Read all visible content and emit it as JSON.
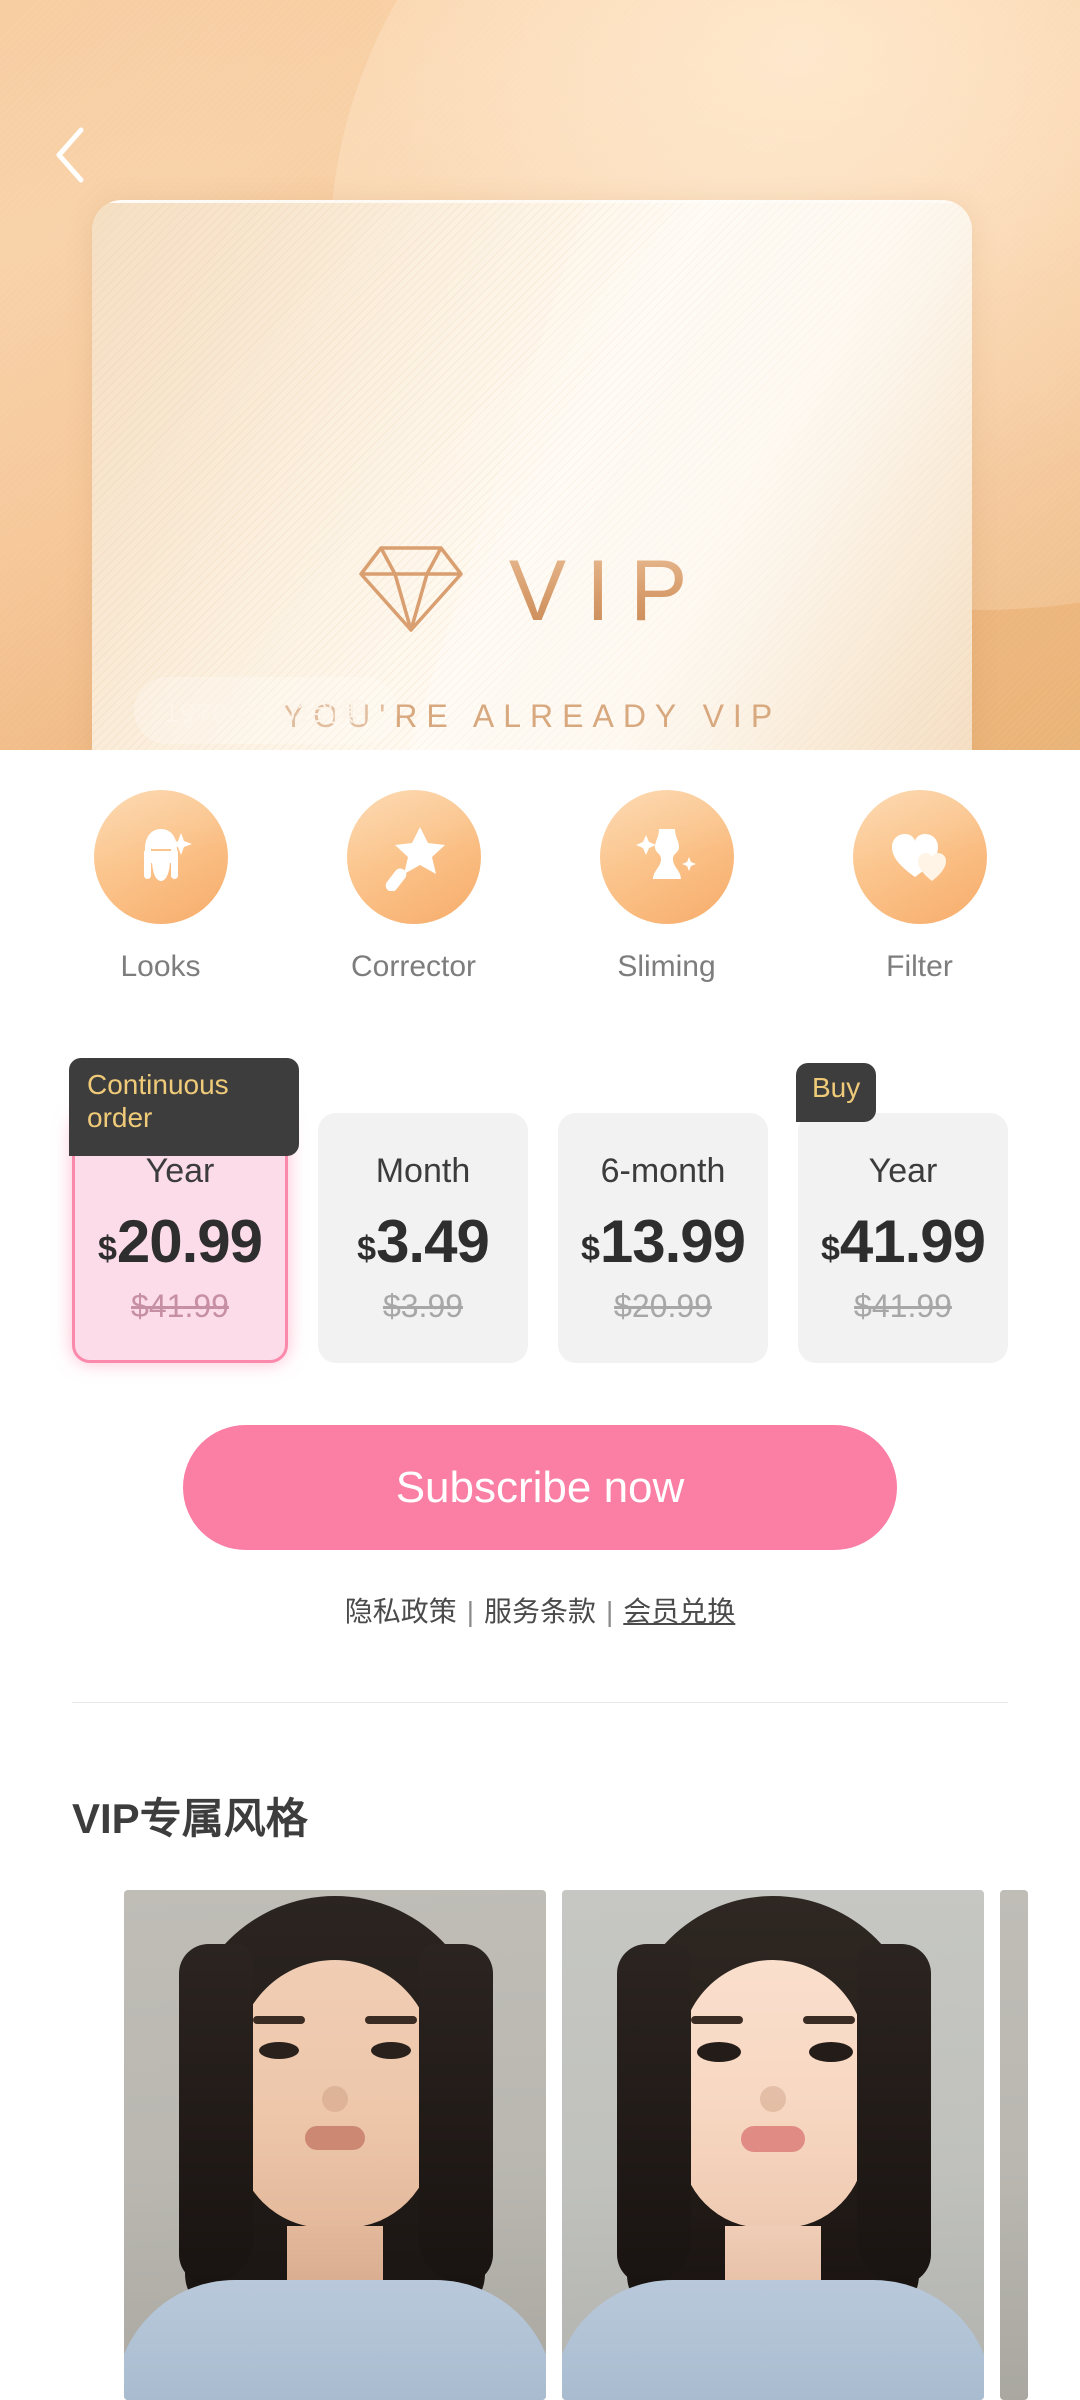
{
  "header": {
    "back_icon": "chevron-left-icon"
  },
  "vip_card": {
    "diamond_icon": "diamond-icon",
    "brand": "VIP",
    "tagline": "YOU'RE ALREADY VIP",
    "expiry": "1970-01-01到期"
  },
  "features": [
    {
      "label": "Looks",
      "icon": "face-sparkle-icon"
    },
    {
      "label": "Corrector",
      "icon": "magic-wand-icon"
    },
    {
      "label": "Sliming",
      "icon": "dress-sparkle-icon"
    },
    {
      "label": "Filter",
      "icon": "double-heart-icon"
    }
  ],
  "plans": [
    {
      "badge": "Continuous order",
      "period": "Year",
      "currency": "$",
      "price": "20.99",
      "old_price": "$41.99",
      "selected": true
    },
    {
      "badge": "",
      "period": "Month",
      "currency": "$",
      "price": "3.49",
      "old_price": "$3.99",
      "selected": false
    },
    {
      "badge": "",
      "period": "6-month",
      "currency": "$",
      "price": "13.99",
      "old_price": "$20.99",
      "selected": false
    },
    {
      "badge": "Buy",
      "period": "Year",
      "currency": "$",
      "price": "41.99",
      "old_price": "$41.99",
      "selected": false
    }
  ],
  "cta": {
    "label": "Subscribe now"
  },
  "legal": {
    "privacy": "隐私政策",
    "terms": "服务条款",
    "redeem": "会员兑换",
    "separator": "|"
  },
  "styles_section": {
    "title": "VIP专属风格"
  },
  "colors": {
    "accent_pink": "#fb7ea4",
    "selected_pink_bg": "#fcdce8",
    "selected_pink_border": "#fb89ab",
    "badge_dark": "#3e3d3d",
    "badge_gold": "#efcb79",
    "icon_orange": "#f7ac6a",
    "hero_peach": "#f6c89a"
  }
}
